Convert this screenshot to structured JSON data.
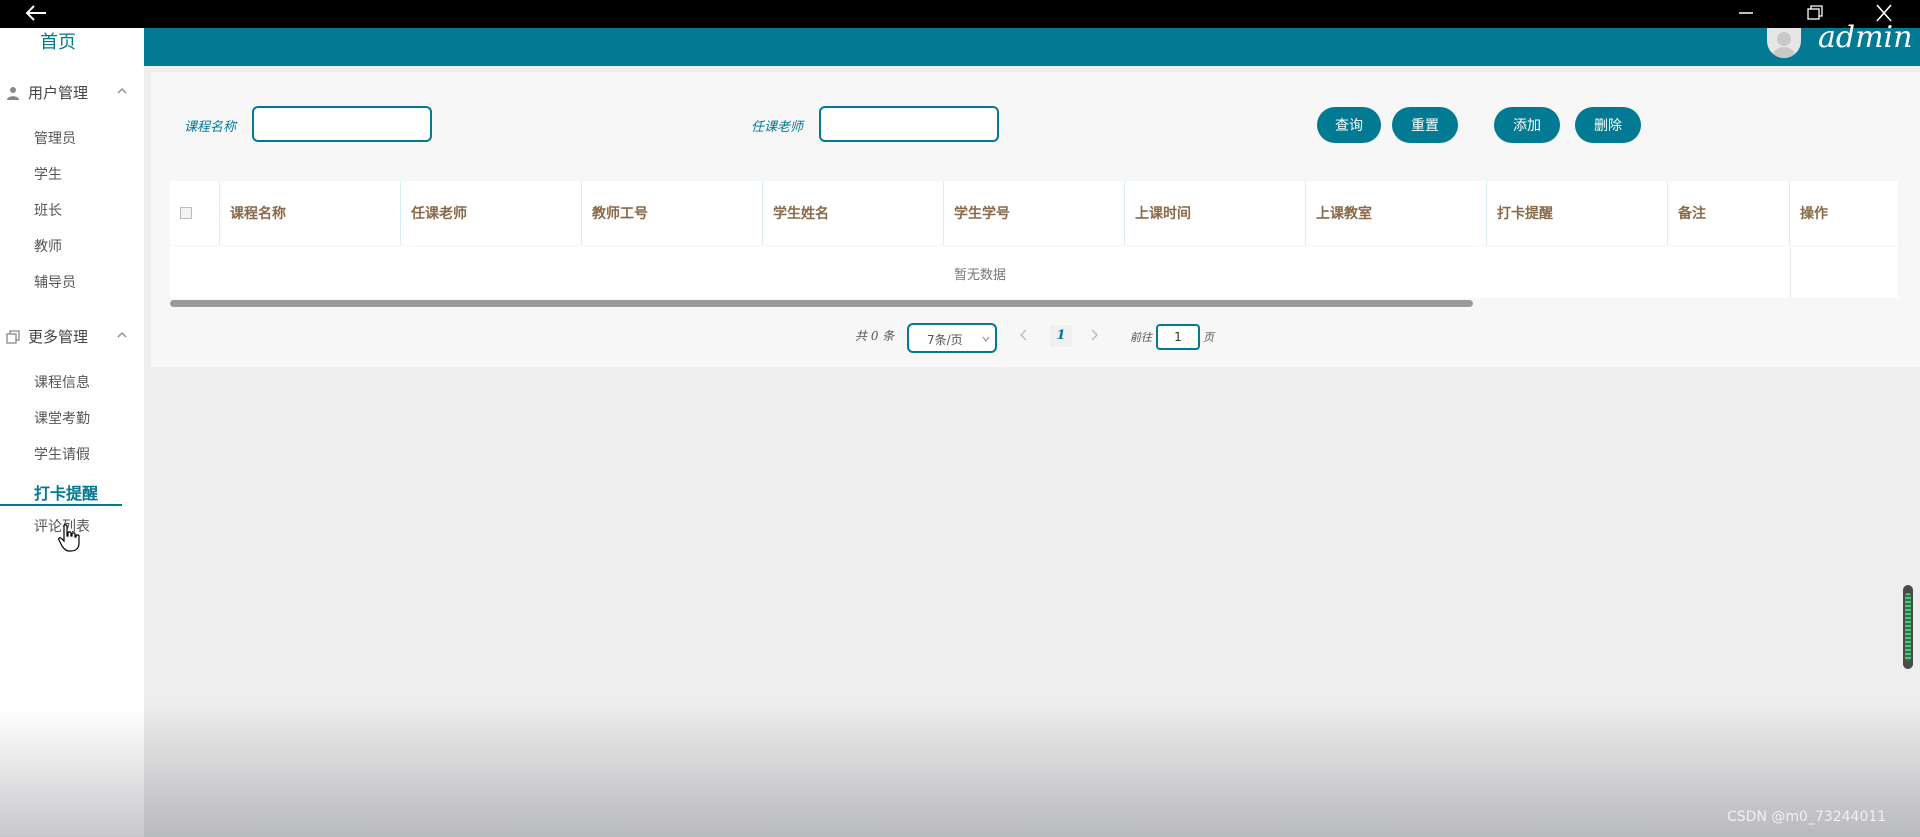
{
  "header": {
    "username": "admin"
  },
  "sidebar": {
    "home": "首页",
    "groups": [
      {
        "label": "用户管理",
        "items": [
          "管理员",
          "学生",
          "班长",
          "教师",
          "辅导员"
        ]
      },
      {
        "label": "更多管理",
        "items": [
          "课程信息",
          "课堂考勤",
          "学生请假",
          "打卡提醒",
          "评论列表"
        ]
      }
    ],
    "active_item": "打卡提醒"
  },
  "search": {
    "course_label": "课程名称",
    "course_value": "",
    "teacher_label": "任课老师",
    "teacher_value": ""
  },
  "buttons": {
    "query": "查询",
    "reset": "重置",
    "add": "添加",
    "delete": "删除"
  },
  "table": {
    "columns": [
      "课程名称",
      "任课老师",
      "教师工号",
      "学生姓名",
      "学生学号",
      "上课时间",
      "上课教室",
      "打卡提醒",
      "备注",
      "操作"
    ],
    "empty_text": "暂无数据"
  },
  "pagination": {
    "total": "共 0 条",
    "page_size": "7条/页",
    "current_page": "1",
    "goto_label": "前往",
    "goto_value": "1",
    "page_suffix": "页"
  },
  "watermark": "CSDN @m0_73244011",
  "colors": {
    "primary": "#027a93",
    "header_text": "#8a6a4a"
  }
}
